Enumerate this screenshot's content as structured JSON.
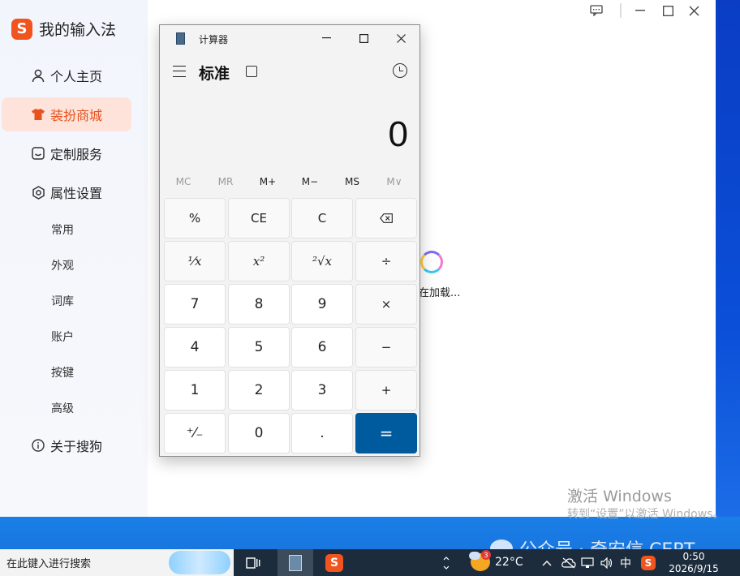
{
  "sogou": {
    "app_title": "我的输入法",
    "logo_letter": "S",
    "nav": [
      {
        "label": "个人主页",
        "icon": "person-icon"
      },
      {
        "label": "装扮商城",
        "icon": "shirt-icon"
      },
      {
        "label": "定制服务",
        "icon": "inbox-icon"
      },
      {
        "label": "属性设置",
        "icon": "gear-icon"
      }
    ],
    "sub_items": [
      "常用",
      "外观",
      "词库",
      "账户",
      "按键",
      "高级"
    ],
    "about": {
      "label": "关于搜狗",
      "icon": "info-icon"
    },
    "loading_text": "在加载..."
  },
  "calculator": {
    "title": "计算器",
    "mode": "标准",
    "display": "0",
    "memory": [
      "MC",
      "MR",
      "M+",
      "M−",
      "MS",
      "M∨"
    ],
    "keys": [
      [
        "%",
        "CE",
        "C",
        "⌫"
      ],
      [
        "¹⁄x",
        "x²",
        "²√x",
        "÷"
      ],
      [
        "7",
        "8",
        "9",
        "×"
      ],
      [
        "4",
        "5",
        "6",
        "−"
      ],
      [
        "1",
        "2",
        "3",
        "+"
      ],
      [
        "⁺⁄₋",
        "0",
        ".",
        "="
      ]
    ],
    "accent_color": "#005a9e"
  },
  "watermark": {
    "activate_title": "激活 Windows",
    "activate_hint": "转到“设置”以激活 Windows。",
    "wechat": "公众号 · 奇安信 CERT"
  },
  "taskbar": {
    "search_placeholder": "在此键入进行搜索",
    "weather_temp": "22°C",
    "weather_badge": "3",
    "ime": "中",
    "time": "0:50",
    "date": "2026/9/15"
  }
}
